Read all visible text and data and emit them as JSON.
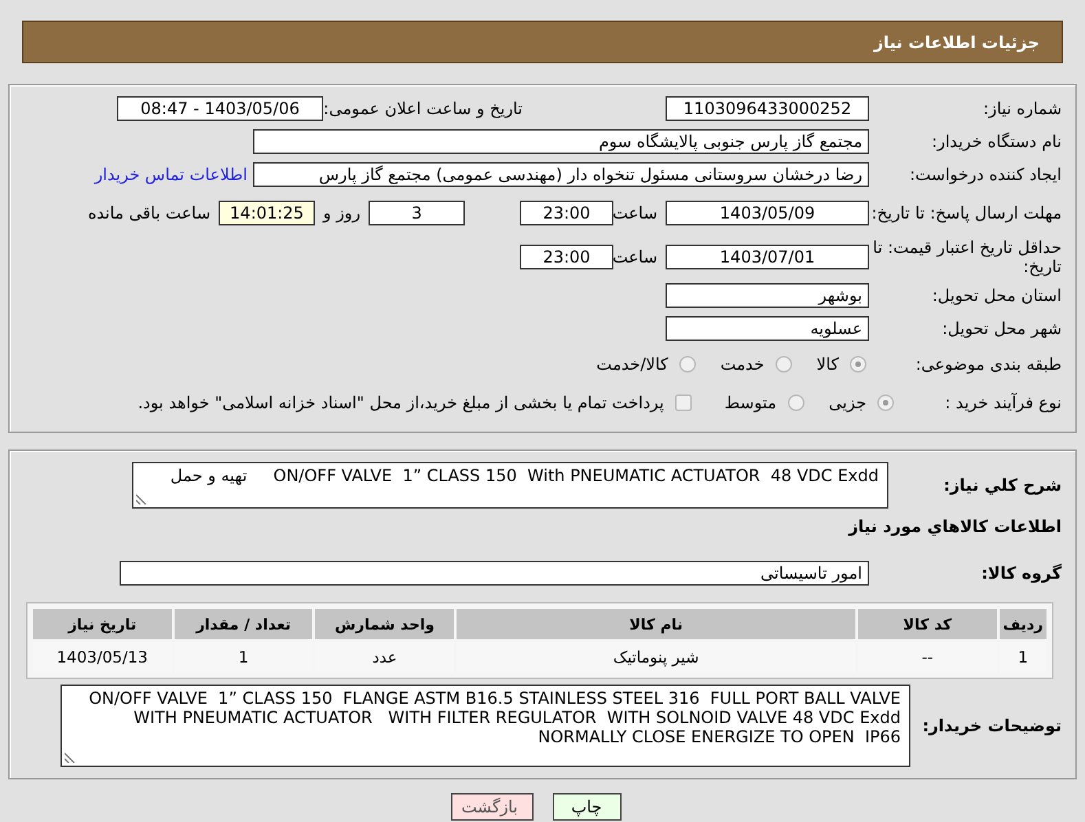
{
  "header": {
    "title": "جزئیات اطلاعات نیاز"
  },
  "need_number": {
    "label": "شماره نیاز:",
    "value": "1103096433000252"
  },
  "announce": {
    "label": "تاریخ و ساعت اعلان عمومی:",
    "value": "1403/05/06 - 08:47"
  },
  "buyer_org": {
    "label": "نام دستگاه خریدار:",
    "value": "مجتمع گاز پارس جنوبی  پالایشگاه سوم"
  },
  "requester": {
    "label": "ایجاد کننده درخواست:",
    "value": "رضا درخشان سروستانی مسئول تنخواه دار  (مهندسی عمومی) مجتمع گاز پارس",
    "link": "اطلاعات تماس خریدار"
  },
  "deadline": {
    "label": "مهلت ارسال پاسخ: تا تاریخ:",
    "date": "1403/05/09",
    "time_label": "ساعت",
    "time": "23:00",
    "days": "3",
    "days_label": "روز و",
    "remaining": "14:01:25",
    "remaining_label": "ساعت باقی مانده"
  },
  "validity": {
    "label": "حداقل تاریخ اعتبار قیمت: تا تاریخ:",
    "date": "1403/07/01",
    "time_label": "ساعت",
    "time": "23:00"
  },
  "province": {
    "label": "استان محل تحویل:",
    "value": "بوشهر"
  },
  "city": {
    "label": "شهر محل تحویل:",
    "value": "عسلویه"
  },
  "category": {
    "label": "طبقه بندی موضوعی:",
    "options": [
      {
        "label": "کالا",
        "selected": true
      },
      {
        "label": "خدمت",
        "selected": false
      },
      {
        "label": "کالا/خدمت",
        "selected": false
      }
    ]
  },
  "process": {
    "label": "نوع فرآیند خرید :",
    "options": [
      {
        "label": "جزیی",
        "selected": true
      },
      {
        "label": "متوسط",
        "selected": false
      }
    ],
    "treasury": {
      "label": "پرداخت تمام یا بخشی از مبلغ خرید،از محل \"اسناد خزانه اسلامی\" خواهد بود.",
      "checked": false
    }
  },
  "summary": {
    "label": "شرح کلي نياز:",
    "value": "ON/OFF VALVE  1” CLASS 150  With PNEUMATIC ACTUATOR  48 VDC Exdd     تهیه و حمل"
  },
  "goods_title": "اطلاعات كالاهاي مورد نياز",
  "goods_group": {
    "label": "گروه کالا:",
    "value": "امور تاسیساتی"
  },
  "table": {
    "columns": [
      "ردیف",
      "کد کالا",
      "نام کالا",
      "واحد شمارش",
      "تعداد / مقدار",
      "تاریخ نیاز"
    ],
    "rows": [
      [
        "1",
        "--",
        "شیر پنوماتیک",
        "عدد",
        "1",
        "1403/05/13"
      ]
    ]
  },
  "buyer_notes": {
    "label": "توضیحات خریدار:",
    "value": "ON/OFF VALVE  1” CLASS 150  FLANGE ASTM B16.5 STAINLESS STEEL 316  FULL PORT BALL VALVE  WITH PNEUMATIC ACTUATOR   WITH FILTER REGULATOR  WITH SOLNOID VALVE 48 VDC Exdd NORMALLY CLOSE ENERGIZE TO OPEN  IP66"
  },
  "buttons": [
    {
      "label": "چاپ",
      "kind": "print"
    },
    {
      "label": "بازگشت",
      "kind": "back"
    }
  ]
}
